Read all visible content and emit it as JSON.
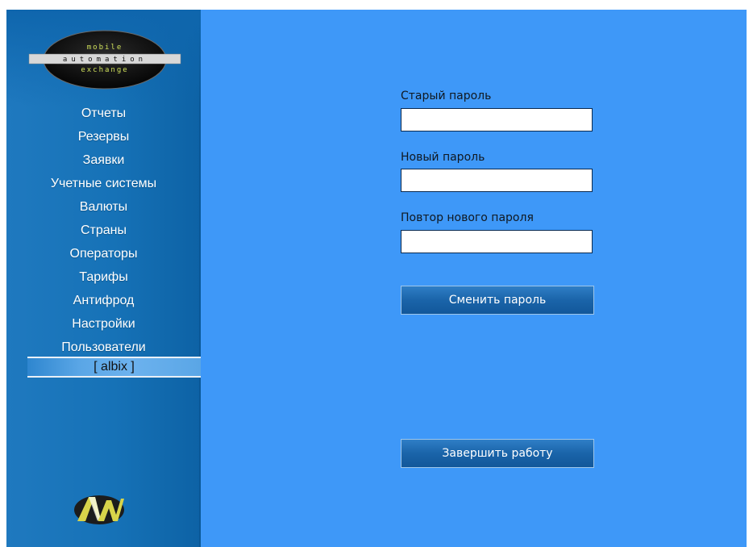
{
  "sidebar": {
    "logo": {
      "line1": "mobile",
      "line2": "automation",
      "line3": "exchange"
    },
    "items": [
      {
        "label": "Отчеты"
      },
      {
        "label": "Резервы"
      },
      {
        "label": "Заявки"
      },
      {
        "label": "Учетные системы"
      },
      {
        "label": "Валюты"
      },
      {
        "label": "Страны"
      },
      {
        "label": "Операторы"
      },
      {
        "label": "Тарифы"
      },
      {
        "label": "Антифрод"
      },
      {
        "label": "Настройки"
      },
      {
        "label": "Пользователи"
      }
    ],
    "current_user": "[ albix ]",
    "footer_logo": "AW"
  },
  "form": {
    "old_password_label": "Старый пароль",
    "old_password_value": "",
    "new_password_label": "Новый пароль",
    "new_password_value": "",
    "repeat_password_label": "Повтор нового пароля",
    "repeat_password_value": "",
    "change_button": "Сменить пароль",
    "logout_button": "Завершить работу"
  },
  "colors": {
    "main_background": "#3e98f8",
    "sidebar_background": "#1672b7",
    "button_background": "#1a64a9"
  }
}
